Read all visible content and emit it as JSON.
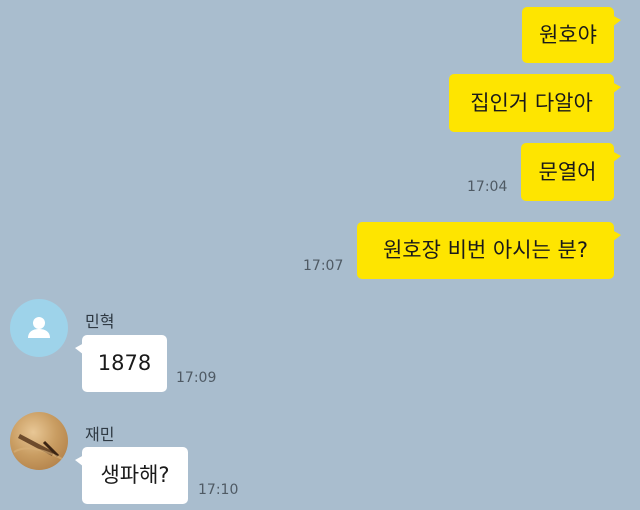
{
  "messages": {
    "m1": {
      "text": "원호야"
    },
    "m2": {
      "text": "집인거 다알아"
    },
    "m3": {
      "text": "문열어",
      "time": "17:04"
    },
    "m4": {
      "text": "원호장 비번 아시는 분?",
      "time": "17:07"
    },
    "m5": {
      "sender": "민혁",
      "text": "1878",
      "time": "17:09"
    },
    "m6": {
      "sender": "재민",
      "text": "생파해?",
      "time": "17:10"
    }
  },
  "avatars": {
    "minhyuk": {
      "icon": "default-person-icon",
      "color": "#9ed3ea"
    },
    "jaemin": {
      "icon": "profile-photo"
    }
  },
  "colors": {
    "background": "#a9bdce",
    "my_bubble": "#fee500",
    "other_bubble": "#ffffff"
  }
}
